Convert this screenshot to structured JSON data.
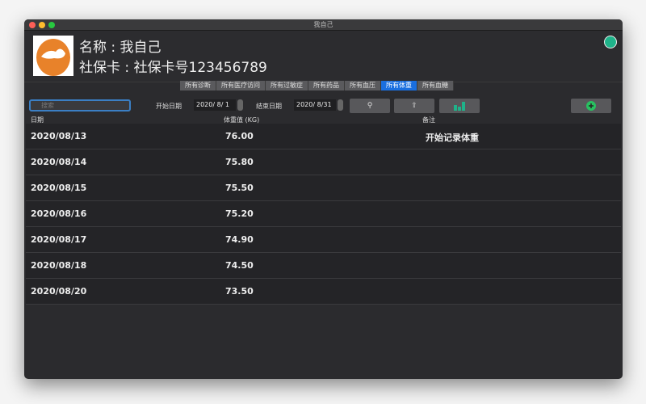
{
  "window": {
    "title": "我自己"
  },
  "profile": {
    "name": "名称 : 我自己",
    "card": "社保卡 : 社保卡号123456789"
  },
  "tabs": [
    {
      "label": "所有诊断"
    },
    {
      "label": "所有医疗访问"
    },
    {
      "label": "所有过敏症"
    },
    {
      "label": "所有药品"
    },
    {
      "label": "所有血压"
    },
    {
      "label": "所有体重",
      "active": true
    },
    {
      "label": "所有血糖"
    }
  ],
  "toolbar": {
    "search_placeholder": "搜索",
    "start_label": "开始日期",
    "start_date": "2020/  8/  1",
    "end_label": "结束日期",
    "end_date": "2020/  8/31",
    "search_icon": "⚲",
    "share_icon": "⇪"
  },
  "columns": {
    "date": "日期",
    "weight": "体重值 (KG)",
    "note": "备注"
  },
  "rows": [
    {
      "date": "2020/08/13",
      "weight": "76.00",
      "note": "开始记录体重"
    },
    {
      "date": "2020/08/14",
      "weight": "75.80",
      "note": ""
    },
    {
      "date": "2020/08/15",
      "weight": "75.50",
      "note": ""
    },
    {
      "date": "2020/08/16",
      "weight": "75.20",
      "note": ""
    },
    {
      "date": "2020/08/17",
      "weight": "74.90",
      "note": ""
    },
    {
      "date": "2020/08/18",
      "weight": "74.50",
      "note": ""
    },
    {
      "date": "2020/08/20",
      "weight": "73.50",
      "note": ""
    }
  ],
  "colors": {
    "accent": "#1a6fe0",
    "green": "#1fb38a"
  }
}
